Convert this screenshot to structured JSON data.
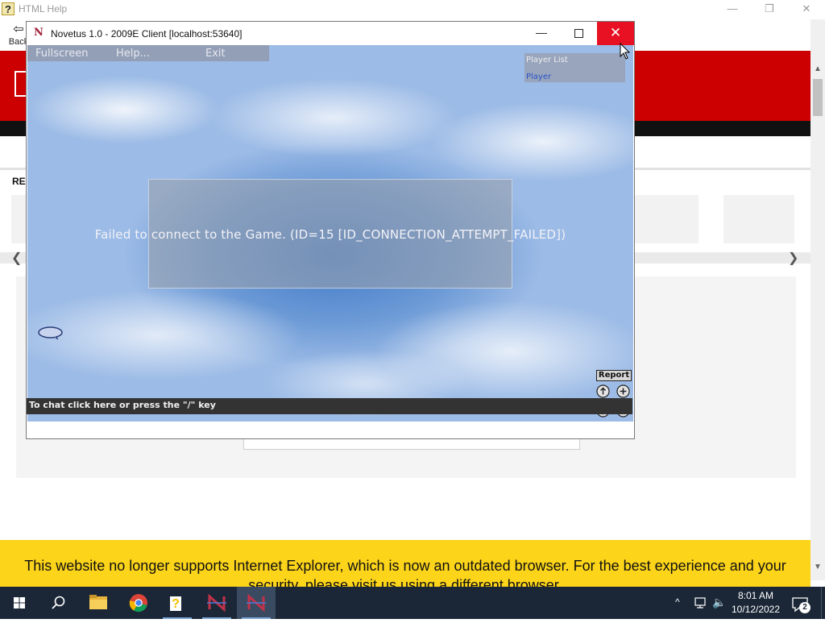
{
  "background_window": {
    "title": "HTML Help",
    "back_label": "Back",
    "recommended_label": "REC",
    "banner_text": "This website no longer supports Internet Explorer, which is now an outdated browser. For the best experience and your security, please visit us using a different browser.",
    "colors": {
      "header": "#cc0000",
      "banner": "#fcd41a"
    }
  },
  "novetus": {
    "title": "Novetus 1.0 - 2009E Client [localhost:53640]",
    "menu": [
      "Fullscreen",
      "Help...",
      "Exit"
    ],
    "player_list": {
      "title": "Player List",
      "players": [
        "Player"
      ]
    },
    "error_message": "Failed to connect to the Game. (ID=15 [ID_CONNECTION_ATTEMPT_FAILED])",
    "report_label": "Report",
    "chat_hint": "To chat click here or press the \"/\" key",
    "close_color": "#e81123"
  },
  "taskbar": {
    "apps": [
      "file-explorer-icon",
      "chrome-icon",
      "html-help-icon",
      "novetus-icon",
      "novetus-client-icon"
    ],
    "time": "8:01 AM",
    "date": "10/12/2022",
    "notification_count": "2"
  }
}
